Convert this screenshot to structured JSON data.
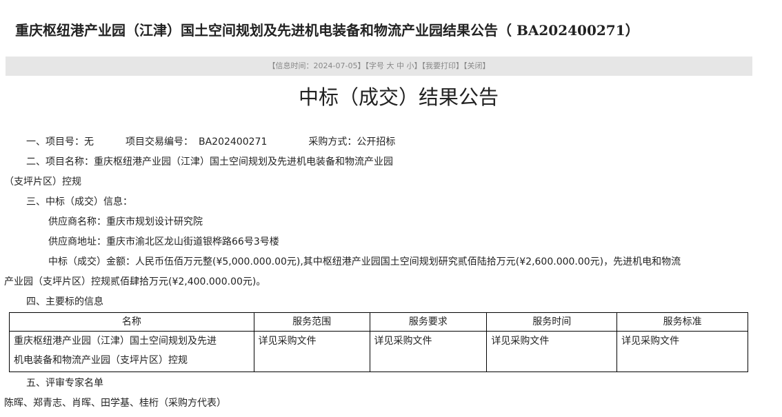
{
  "title": "重庆枢纽港产业园（江津）国土空间规划及先进机电装备和物流产业园结果公告（ BA202400271）",
  "info_bar": {
    "time_label": "【信息时间：",
    "date": "2024-07-05",
    "time_close": "】",
    "font_size_label": "【字号",
    "large": "大",
    "medium": "中",
    "small": "小",
    "font_size_close": "】",
    "print": "【我要打印】",
    "close": "【关闭】"
  },
  "notice_title": "中标（成交）结果公告",
  "section1": {
    "project_no_label": "一、项目号：",
    "project_no": "无",
    "trade_no_label": "项目交易编号：",
    "trade_no": "BA202400271",
    "method_label": "采购方式：",
    "method": "公开招标"
  },
  "section2": {
    "label": "二、项目名称：",
    "name_line1": "重庆枢纽港产业园（江津）国土空间规划及先进机电装备和物流产业园",
    "name_line2": "（支坪片区）控规"
  },
  "section3": {
    "label": "三、中标（成交）信息：",
    "supplier_name_label": "供应商名称：",
    "supplier_name": "重庆市规划设计研究院",
    "supplier_address_label": "供应商地址：",
    "supplier_address": "重庆市渝北区龙山街道银桦路66号3号楼",
    "amount_line1": "中标（成交）金额：人民币伍佰万元整(¥5,000.000.00元),其中枢纽港产业园国土空间规划研究贰佰陆拾万元(¥2,600.000.00元)，先进机电和物流",
    "amount_line2": "产业园（支坪片区）控规贰佰肆拾万元(¥2,400.000.00元)。"
  },
  "section4": {
    "label": "四、主要标的信息",
    "headers": [
      "名称",
      "服务范围",
      "服务要求",
      "服务时间",
      "服务标准"
    ],
    "row": {
      "name_line1": "重庆枢纽港产业园（江津）国土空间规划及先进",
      "name_line2": "机电装备和物流产业园（支坪片区）控规",
      "scope": "详见采购文件",
      "requirement": "详见采购文件",
      "time": "详见采购文件",
      "standard": "详见采购文件"
    }
  },
  "section5": {
    "label": "五、评审专家名单",
    "experts": "陈晖、郑青志、肖晖、田学基、桂桁（采购方代表）"
  }
}
